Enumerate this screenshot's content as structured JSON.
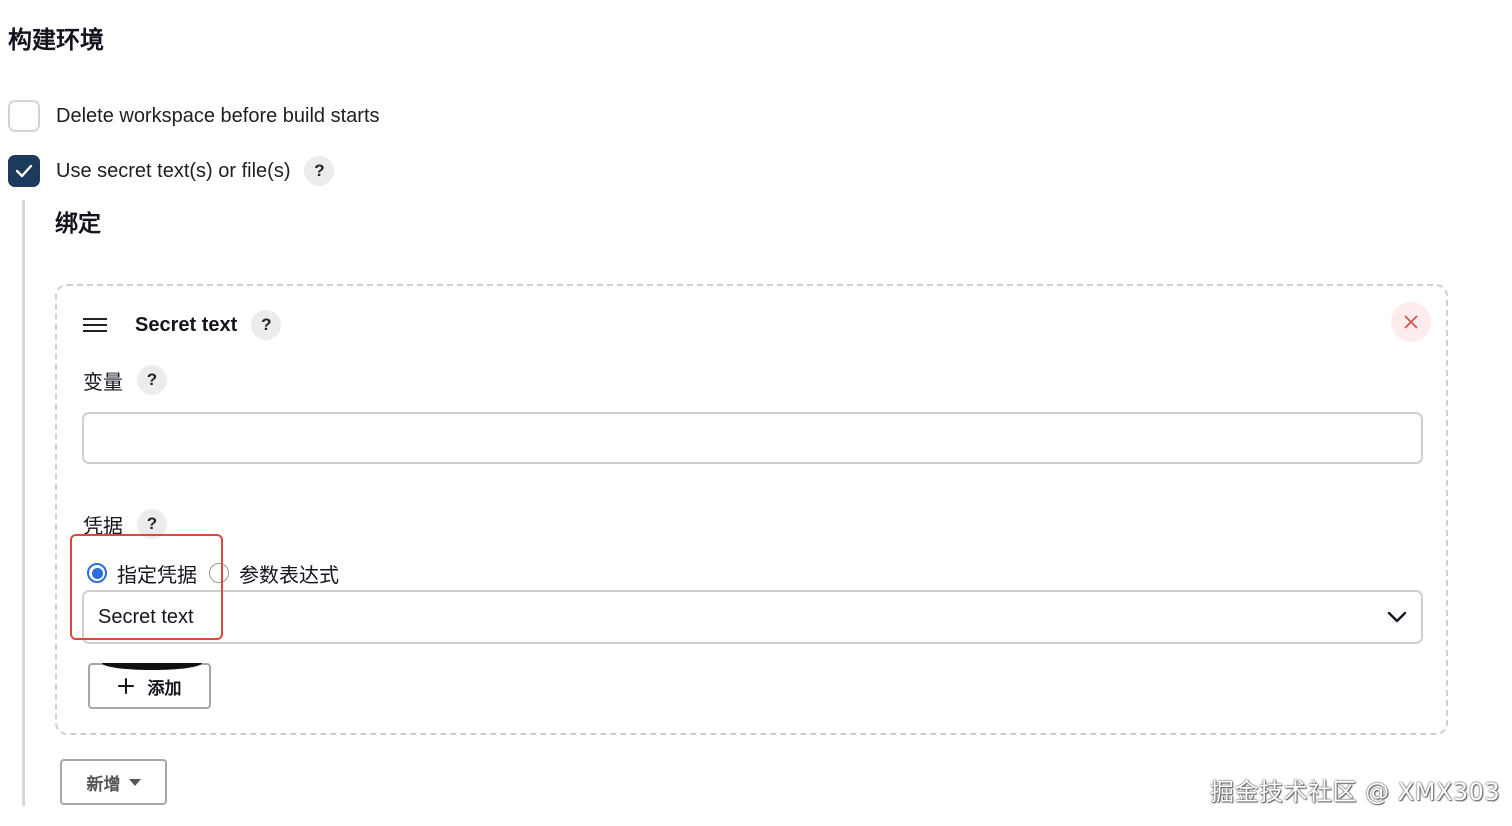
{
  "section": {
    "title": "构建环境"
  },
  "options": [
    {
      "label": "Delete workspace before build starts",
      "checked": false
    },
    {
      "label": "Use secret text(s) or file(s)",
      "checked": true,
      "help": "?"
    }
  ],
  "bindings": {
    "title": "绑定",
    "card": {
      "title": "Secret text",
      "help": "?",
      "variable": {
        "label": "变量",
        "help": "?",
        "value": "",
        "placeholder": ""
      },
      "credentials": {
        "label": "凭据",
        "help": "?",
        "radio_options": [
          {
            "label": "指定凭据",
            "selected": true
          },
          {
            "label": "参数表达式",
            "selected": false
          }
        ],
        "select_value": "Secret text",
        "add_label": "添加"
      }
    },
    "new_label": "新增"
  },
  "colors": {
    "accent": "#1c3a5c",
    "radio": "#2b6ed9",
    "highlight": "#e0463a",
    "close_bg": "#fdeceb",
    "close_icon": "#d9534f"
  },
  "icons": {
    "check": "check-icon",
    "help": "help-icon",
    "drag": "drag-handle-icon",
    "close": "close-icon",
    "chevron": "chevron-down-icon",
    "plus": "plus-icon",
    "caret": "caret-down-icon"
  },
  "watermark": "掘金技术社区 @ XMX303"
}
